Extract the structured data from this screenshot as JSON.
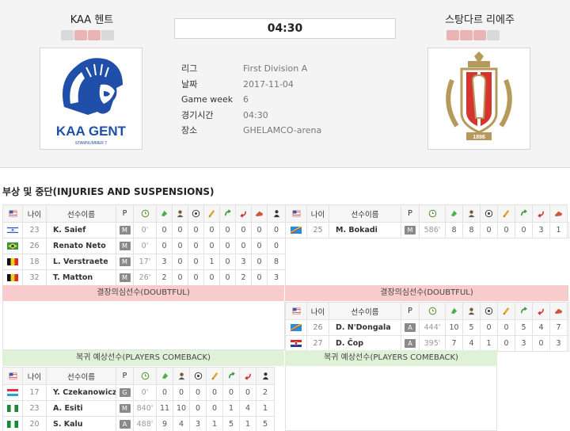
{
  "clock": "04:30",
  "home": {
    "name": "KAA 헨트",
    "form": [
      "L",
      "W",
      "W",
      "L"
    ],
    "logo_text": "KAA GENT",
    "logo_sub": "STAMNUMMER 7"
  },
  "away": {
    "name": "스탕다르 리에주",
    "form": [
      "W",
      "W",
      "W",
      "L"
    ],
    "logo_year": "1898"
  },
  "info": [
    {
      "label": "리그",
      "value": "First Division A"
    },
    {
      "label": "날짜",
      "value": "2017-11-04"
    },
    {
      "label": "Game week",
      "value": "6"
    },
    {
      "label": "경기시간",
      "value": "04:30"
    },
    {
      "label": "장소",
      "value": "GHELAMCO-arena"
    }
  ],
  "section_title": "부상 및 중단(INJURIES AND SUSPENSIONS)",
  "headers": {
    "age": "나이",
    "name": "선수이름",
    "pos": "P"
  },
  "bands": {
    "doubtful": "결장의심선수(DOUBTFUL)",
    "comeback": "복귀 예상선수(PLAYERS COMEBACK)"
  },
  "colors": {
    "doubtful_band": "#f8cccc",
    "comeback_band": "#dff2d8"
  },
  "home_injured": [
    {
      "flag": "israel",
      "age": "23",
      "name": "K. Saief",
      "pos": "M",
      "min": "0'",
      "stats": [
        "0",
        "0",
        "0",
        "0",
        "0",
        "0",
        "0",
        "0"
      ],
      "status": "question"
    },
    {
      "flag": "brazil",
      "age": "26",
      "name": "Renato Neto",
      "pos": "M",
      "min": "0'",
      "stats": [
        "0",
        "0",
        "0",
        "0",
        "0",
        "0",
        "0",
        "0"
      ],
      "status": "injury"
    },
    {
      "flag": "belgium",
      "age": "18",
      "name": "L. Verstraete",
      "pos": "M",
      "min": "17'",
      "stats": [
        "3",
        "0",
        "0",
        "1",
        "0",
        "3",
        "0",
        "8"
      ],
      "status": "injury"
    },
    {
      "flag": "belgium",
      "age": "32",
      "name": "T. Matton",
      "pos": "M",
      "min": "26'",
      "stats": [
        "2",
        "0",
        "0",
        "0",
        "0",
        "2",
        "0",
        "3"
      ],
      "status": "question"
    }
  ],
  "away_injured": [
    {
      "flag": "congo",
      "age": "25",
      "name": "M. Bokadi",
      "pos": "M",
      "min": "586'",
      "stats": [
        "8",
        "8",
        "0",
        "0",
        "0",
        "3",
        "1"
      ],
      "status": "injury"
    }
  ],
  "away_doubtful": [
    {
      "flag": "congo",
      "age": "26",
      "name": "D. N'Dongala",
      "pos": "A",
      "min": "444'",
      "stats": [
        "10",
        "5",
        "0",
        "0",
        "5",
        "4",
        "7"
      ]
    },
    {
      "flag": "croatia",
      "age": "27",
      "name": "D. Čop",
      "pos": "A",
      "min": "395'",
      "stats": [
        "7",
        "4",
        "1",
        "0",
        "3",
        "0",
        "3"
      ]
    }
  ],
  "home_comeback": [
    {
      "flag": "luxembourg",
      "age": "17",
      "name": "Y. Czekanowicz",
      "pos": "G",
      "min": "0'",
      "stats": [
        "0",
        "0",
        "0",
        "0",
        "0",
        "0",
        "2"
      ]
    },
    {
      "flag": "nigeria",
      "age": "23",
      "name": "A. Esiti",
      "pos": "M",
      "min": "840'",
      "stats": [
        "11",
        "10",
        "0",
        "0",
        "1",
        "4",
        "1"
      ]
    },
    {
      "flag": "nigeria",
      "age": "20",
      "name": "S. Kalu",
      "pos": "A",
      "min": "488'",
      "stats": [
        "9",
        "4",
        "3",
        "1",
        "5",
        "1",
        "5"
      ]
    }
  ]
}
